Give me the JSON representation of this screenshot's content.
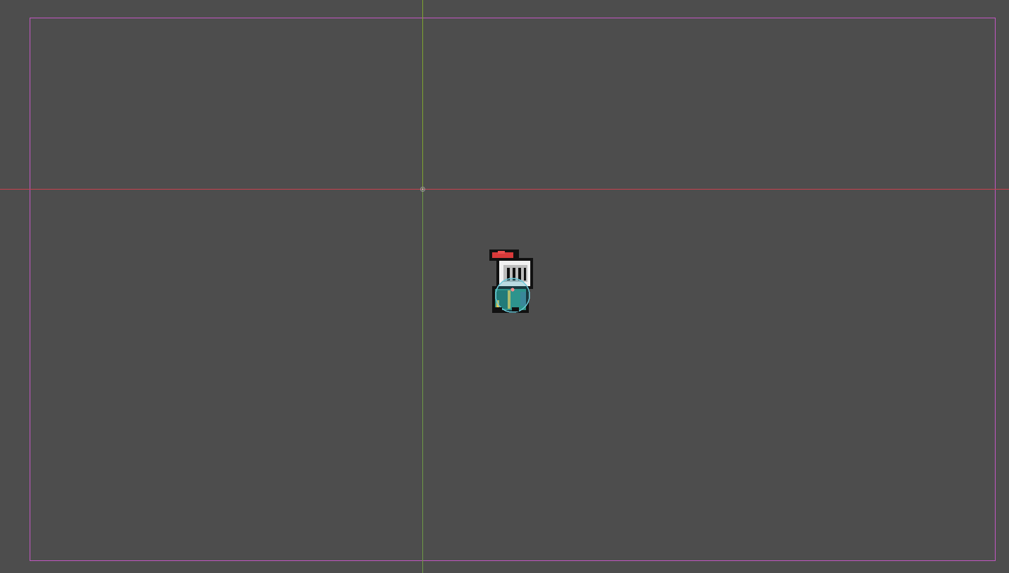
{
  "scene": {
    "background_color": "#4d4d4d",
    "frame_color": "#c257c2",
    "x_axis_color": "#c7414f",
    "y_axis_color": "#7ea52f",
    "origin_marker": "crosshair-icon",
    "sprite": {
      "name": "knight-icon",
      "collision_shape": "circle-collision-shape"
    }
  }
}
